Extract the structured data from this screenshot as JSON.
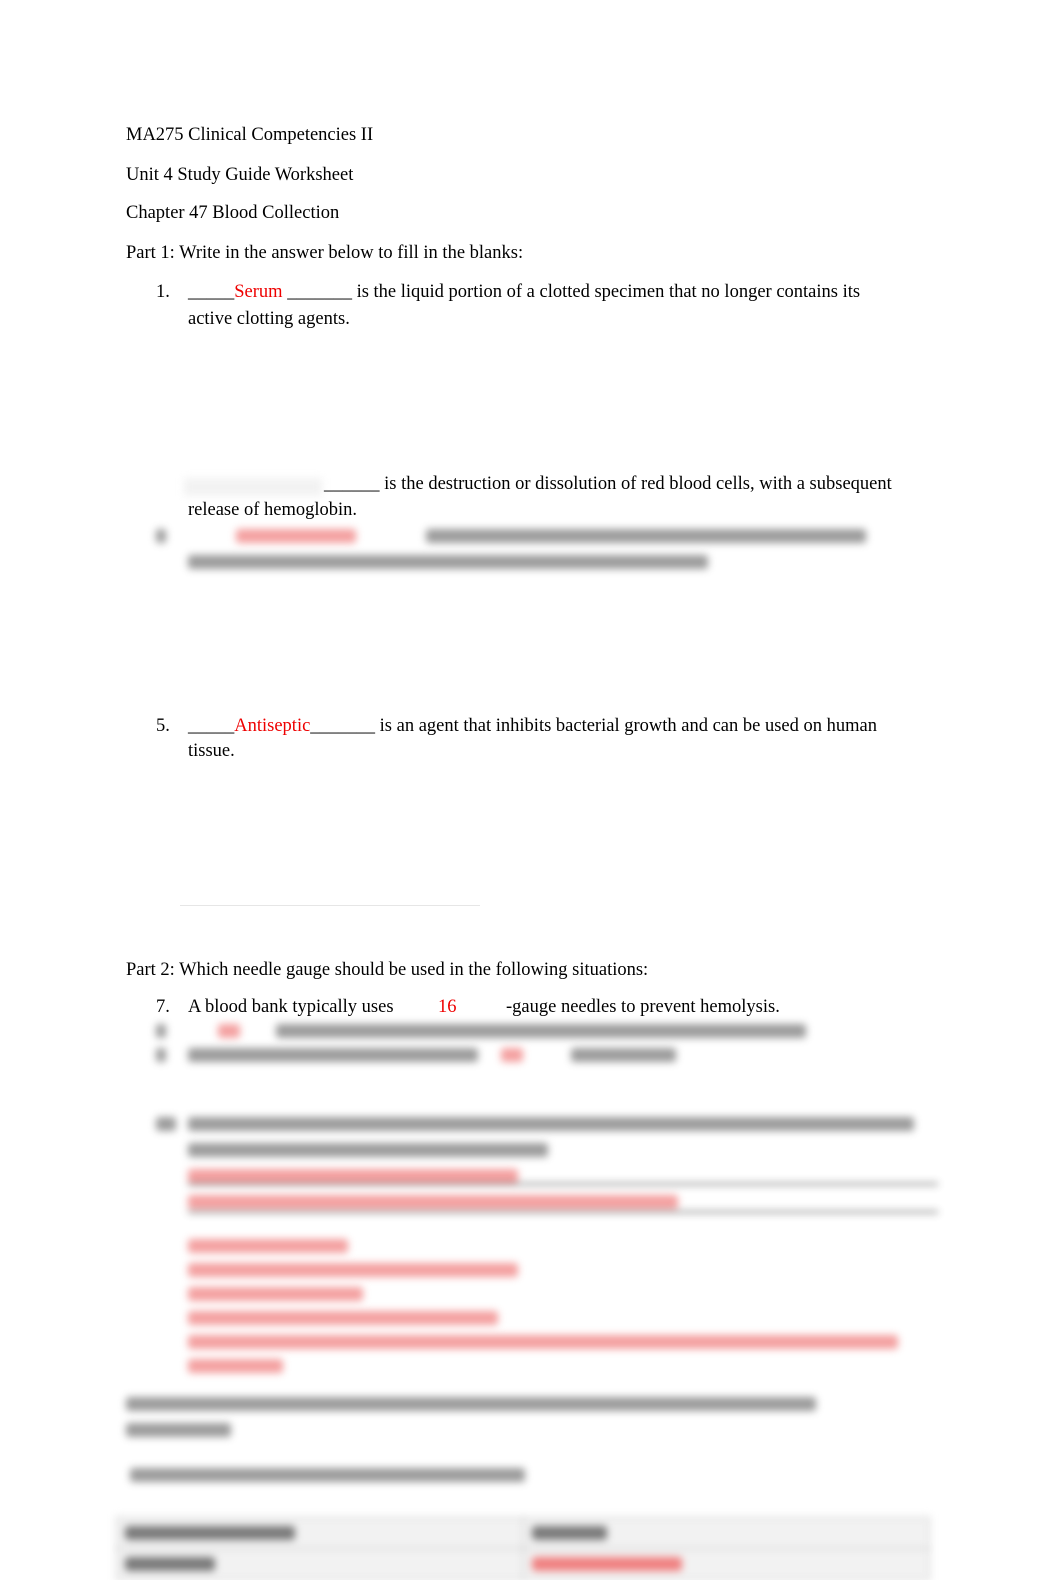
{
  "header": {
    "course": "MA275 Clinical Competencies II",
    "unit": "Unit 4 Study Guide Worksheet",
    "chapter": "Chapter 47 Blood Collection"
  },
  "part1": {
    "heading": "Part 1: Write in the answer below to fill in the blanks:",
    "items": [
      {
        "number": "1.",
        "blank_before": "_____",
        "answer": "Serum",
        "blank_after": " _______",
        "text_line1": " is the liquid portion of a clotted specimen that no longer contains its",
        "text_line2": "active clotting agents."
      },
      {
        "number": "",
        "blank_before": "",
        "answer": "",
        "blank_after": "______",
        "text_line1": " is the destruction or dissolution of red blood cells, with a subsequent",
        "text_line2": "release of hemoglobin."
      },
      {
        "number": "5.",
        "blank_before": "_____",
        "answer": "Antiseptic",
        "blank_after": "_______",
        "text_line1": " is an agent that inhibits bacterial growth and can be used on human",
        "text_line2": "tissue."
      }
    ]
  },
  "part2": {
    "heading": "Part 2: Which needle gauge should be used in the following situations:",
    "items": [
      {
        "number": "7.",
        "before": "A blood bank typically uses",
        "answer": "16",
        "after": "-gauge needles to prevent hemolysis."
      }
    ]
  }
}
